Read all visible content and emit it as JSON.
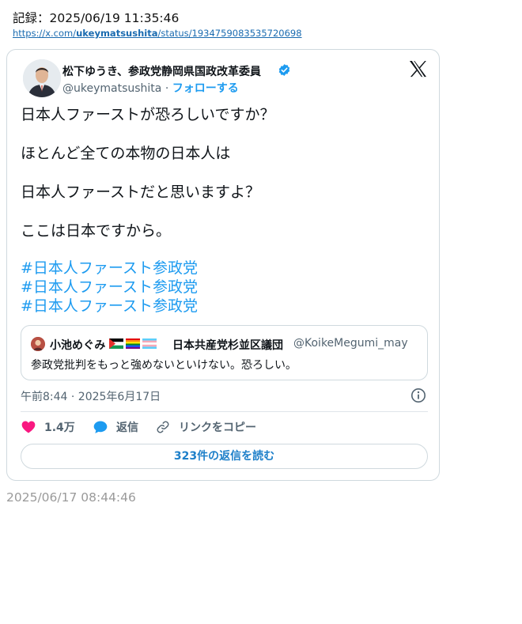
{
  "record": {
    "title": "記録：2025/06/19 11:35:46",
    "url_prefix": "https://x.com/",
    "url_user": "ukeymatsushita",
    "url_suffix": "/status/1934759083535720698"
  },
  "tweet": {
    "author_name": "松下ゆうき、参政党静岡県国政改革委員",
    "handle": "@ukeymatsushita",
    "separator": " · ",
    "follow_label": "フォローする",
    "paragraphs": [
      "日本人ファーストが恐ろしいですか？",
      "ほとんど全ての本物の日本人は",
      "日本人ファーストだと思いますよ？",
      "ここは日本ですから。"
    ],
    "hashtags": [
      "#日本人ファースト参政党",
      "#日本人ファースト参政党",
      "#日本人ファースト参政党"
    ],
    "quote": {
      "name_part1": "小池めぐみ",
      "name_part2": "日本共産党杉並区議団",
      "handle": "@KoikeMegumi_may",
      "text": "参政党批判をもっと強めないといけない。恐ろしい。"
    },
    "timestamp": "午前8:44 · 2025年6月17日",
    "actions": {
      "likes": "1.4万",
      "reply_label": "返信",
      "copy_label": "リンクをコピー"
    },
    "read_replies_label": "323件の返信を読む"
  },
  "footer_time": "2025/06/17 08:44:46",
  "icons": [
    "verified-badge-icon",
    "x-logo-icon",
    "info-icon",
    "heart-icon",
    "reply-bubble-icon",
    "link-icon",
    "palestine-flag-icon",
    "rainbow-flag-icon",
    "transgender-flag-icon"
  ],
  "colors": {
    "link_blue": "#1d9bf0",
    "heart_pink": "#f91880",
    "text_dark": "#0f1419",
    "text_gray": "#536471",
    "border": "#cfd9de"
  }
}
